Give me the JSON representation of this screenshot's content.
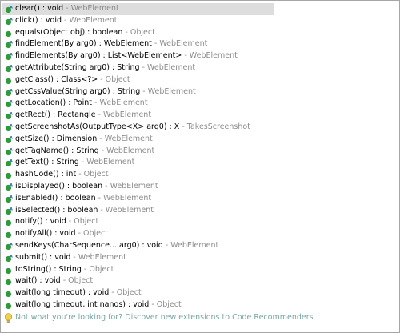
{
  "items": [
    {
      "signature": "clear() : void",
      "qualifier": " - WebElement",
      "icon": "abstract-public-method-icon",
      "abstract": true,
      "selected": true
    },
    {
      "signature": "click() : void",
      "qualifier": " - WebElement",
      "icon": "abstract-public-method-icon",
      "abstract": true,
      "selected": false
    },
    {
      "signature": "equals(Object obj) : boolean",
      "qualifier": " - Object",
      "icon": "public-method-icon",
      "abstract": false,
      "selected": false
    },
    {
      "signature": "findElement(By arg0) : WebElement",
      "qualifier": " - WebElement",
      "icon": "abstract-public-method-icon",
      "abstract": true,
      "selected": false
    },
    {
      "signature": "findElements(By arg0) : List<WebElement>",
      "qualifier": " - WebElement",
      "icon": "abstract-public-method-icon",
      "abstract": true,
      "selected": false
    },
    {
      "signature": "getAttribute(String arg0) : String",
      "qualifier": " - WebElement",
      "icon": "abstract-public-method-icon",
      "abstract": true,
      "selected": false
    },
    {
      "signature": "getClass() : Class<?>",
      "qualifier": " - Object",
      "icon": "public-method-icon",
      "abstract": false,
      "selected": false
    },
    {
      "signature": "getCssValue(String arg0) : String",
      "qualifier": " - WebElement",
      "icon": "abstract-public-method-icon",
      "abstract": true,
      "selected": false
    },
    {
      "signature": "getLocation() : Point",
      "qualifier": " - WebElement",
      "icon": "abstract-public-method-icon",
      "abstract": true,
      "selected": false
    },
    {
      "signature": "getRect() : Rectangle",
      "qualifier": " - WebElement",
      "icon": "abstract-public-method-icon",
      "abstract": true,
      "selected": false
    },
    {
      "signature": "getScreenshotAs(OutputType<X> arg0) : X",
      "qualifier": " - TakesScreenshot",
      "icon": "abstract-public-method-icon",
      "abstract": true,
      "selected": false
    },
    {
      "signature": "getSize() : Dimension",
      "qualifier": " - WebElement",
      "icon": "abstract-public-method-icon",
      "abstract": true,
      "selected": false
    },
    {
      "signature": "getTagName() : String",
      "qualifier": " - WebElement",
      "icon": "abstract-public-method-icon",
      "abstract": true,
      "selected": false
    },
    {
      "signature": "getText() : String",
      "qualifier": " - WebElement",
      "icon": "abstract-public-method-icon",
      "abstract": true,
      "selected": false
    },
    {
      "signature": "hashCode() : int",
      "qualifier": " - Object",
      "icon": "public-method-icon",
      "abstract": false,
      "selected": false
    },
    {
      "signature": "isDisplayed() : boolean",
      "qualifier": " - WebElement",
      "icon": "abstract-public-method-icon",
      "abstract": true,
      "selected": false
    },
    {
      "signature": "isEnabled() : boolean",
      "qualifier": " - WebElement",
      "icon": "abstract-public-method-icon",
      "abstract": true,
      "selected": false
    },
    {
      "signature": "isSelected() : boolean",
      "qualifier": " - WebElement",
      "icon": "abstract-public-method-icon",
      "abstract": true,
      "selected": false
    },
    {
      "signature": "notify() : void",
      "qualifier": " - Object",
      "icon": "public-method-icon",
      "abstract": false,
      "selected": false
    },
    {
      "signature": "notifyAll() : void",
      "qualifier": " - Object",
      "icon": "public-method-icon",
      "abstract": false,
      "selected": false
    },
    {
      "signature": "sendKeys(CharSequence... arg0) : void",
      "qualifier": " - WebElement",
      "icon": "abstract-public-method-icon",
      "abstract": true,
      "selected": false
    },
    {
      "signature": "submit() : void",
      "qualifier": " - WebElement",
      "icon": "abstract-public-method-icon",
      "abstract": true,
      "selected": false
    },
    {
      "signature": "toString() : String",
      "qualifier": " - Object",
      "icon": "public-method-icon",
      "abstract": false,
      "selected": false
    },
    {
      "signature": "wait() : void",
      "qualifier": " - Object",
      "icon": "public-method-icon",
      "abstract": false,
      "selected": false
    },
    {
      "signature": "wait(long timeout) : void",
      "qualifier": " - Object",
      "icon": "public-method-icon",
      "abstract": false,
      "selected": false
    },
    {
      "signature": "wait(long timeout, int nanos) : void",
      "qualifier": " - Object",
      "icon": "public-method-icon",
      "abstract": false,
      "selected": false
    }
  ],
  "footer": {
    "text": "Not what you're looking for? Discover new extensions to Code Recommenders",
    "icon": "lightbulb-icon"
  },
  "colors": {
    "method_green": "#2e9b3a",
    "qualifier_gray": "#8c8c8c",
    "selection_bg": "#dddddd",
    "footer_link": "#77a6a6",
    "bulb_yellow": "#f2d04a"
  }
}
